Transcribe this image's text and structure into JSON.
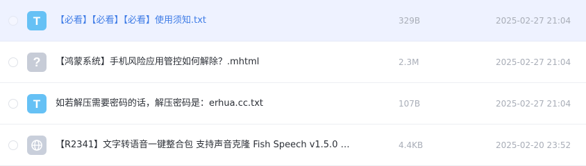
{
  "files": [
    {
      "icon": "txt-file-icon",
      "icon_glyph": "T",
      "name": "【必看】【必看】【必看】使用须知.txt",
      "size": "329B",
      "date": "2025-02-27 21:04",
      "selected": true
    },
    {
      "icon": "unknown-file-icon",
      "icon_glyph": "?",
      "name": "【鸿蒙系统】手机风险应用管控如何解除？.mhtml",
      "size": "2.3M",
      "date": "2025-02-27 21:04",
      "selected": false
    },
    {
      "icon": "txt-file-icon",
      "icon_glyph": "T",
      "name": "如若解压需要密码的话，解压密码是：erhua.cc.txt",
      "size": "107B",
      "date": "2025-02-27 21:04",
      "selected": false
    },
    {
      "icon": "web-link-icon",
      "icon_glyph": "",
      "name": "【R2341】文字转语音一键整合包 支持声音克隆 Fish Speech v1.5.0 …",
      "size": "4.4KB",
      "date": "2025-02-20 23:52",
      "selected": false
    }
  ],
  "colors": {
    "selected_row_bg": "#eef2ff",
    "selected_text": "#3d7be6",
    "txt_icon": "#66c1f5",
    "unknown_icon": "#c7ccd7",
    "web_icon": "#c9cfdb",
    "meta_text": "#a8adb7"
  }
}
